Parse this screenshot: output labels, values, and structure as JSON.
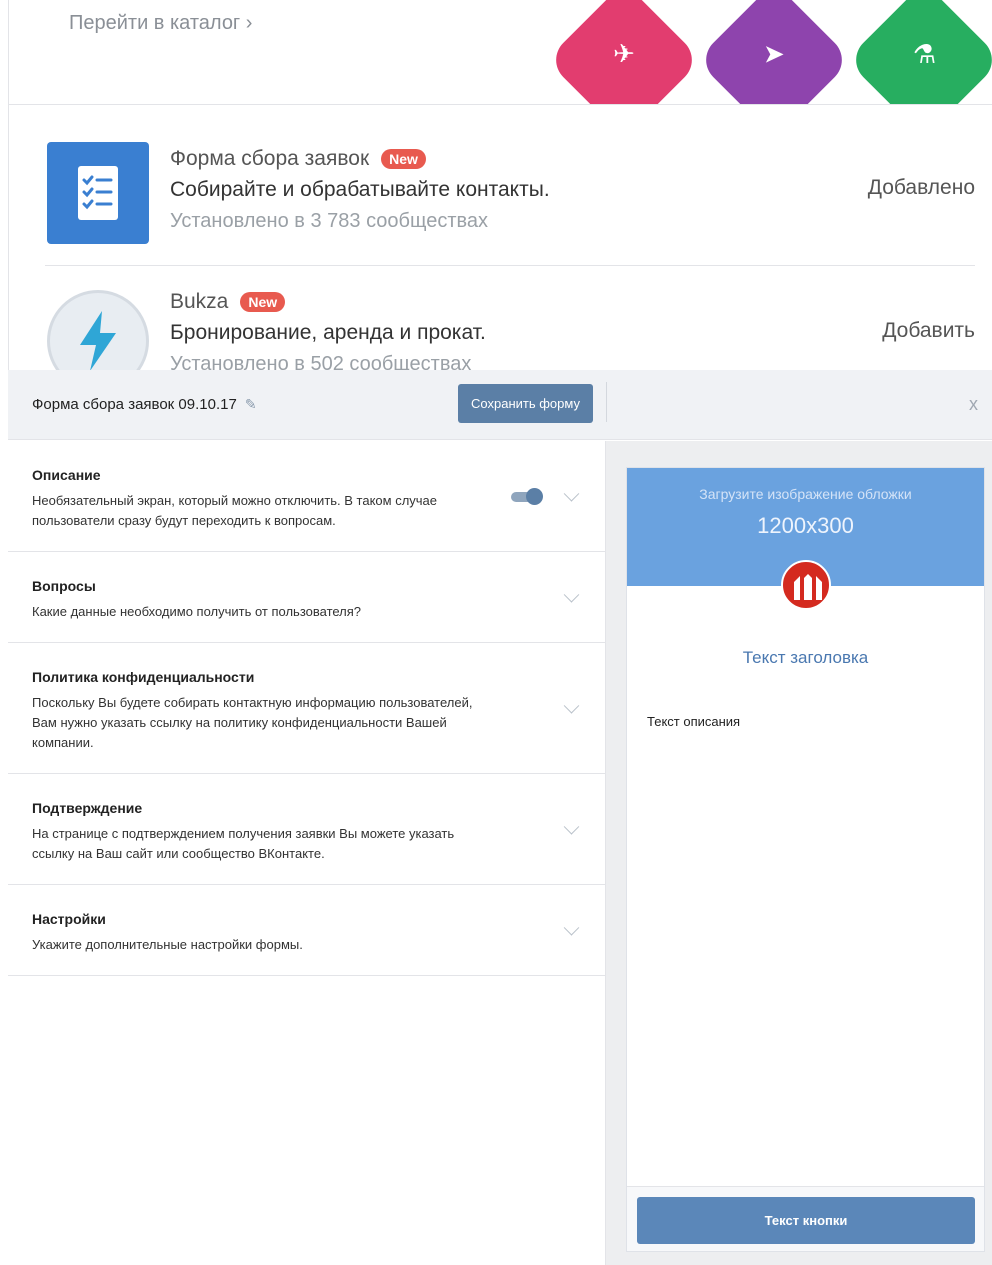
{
  "catalog": {
    "link_label": "Перейти в каталог ›",
    "tiles": [
      {
        "icon": "rocket-glyph",
        "color": "#e23d6f"
      },
      {
        "icon": "rocket-glyph",
        "color": "#8e44ad"
      },
      {
        "icon": "flask-glyph",
        "color": "#27ae60"
      }
    ],
    "apps": [
      {
        "title": "Форма сбора заявок",
        "badge": "New",
        "description": "Собирайте и обрабатывайте контакты.",
        "installed": "Установлено в 3 783 сообществах",
        "action": "Добавлено",
        "icon": "form-list-icon"
      },
      {
        "title": "Bukza",
        "badge": "New",
        "description": "Бронирование, аренда и прокат.",
        "installed": "Установлено в 502 сообществах",
        "action": "Добавить",
        "icon": "lightning-icon"
      }
    ]
  },
  "editor": {
    "title": "Форма сбора заявок 09.10.17",
    "save_label": "Сохранить форму",
    "close_label": "x",
    "sections": [
      {
        "title": "Описание",
        "desc": "Необязательный экран, который можно отключить. В таком случае пользователи сразу будут переходить к вопросам.",
        "toggle_on": true
      },
      {
        "title": "Вопросы",
        "desc": "Какие данные необходимо получить от пользователя?"
      },
      {
        "title": "Политика конфиденциальности",
        "desc": "Поскольку Вы будете собирать контактную информацию пользователей, Вам нужно указать ссылку на политику конфиденциальности Вашей компании."
      },
      {
        "title": "Подтверждение",
        "desc": "На странице с подтверждением получения заявки Вы можете указать ссылку на Ваш сайт или сообщество ВКонтакте."
      },
      {
        "title": "Настройки",
        "desc": "Укажите дополнительные настройки формы."
      }
    ]
  },
  "preview": {
    "cover_text": "Загрузите изображение обложки",
    "cover_size": "1200x300",
    "heading": "Текст заголовка",
    "description": "Текст описания",
    "button_label": "Текст кнопки",
    "colors": {
      "cover": "#6aa2df",
      "logo": "#d42a1f",
      "button": "#5b87b9",
      "accent": "#5b7fa6"
    }
  }
}
